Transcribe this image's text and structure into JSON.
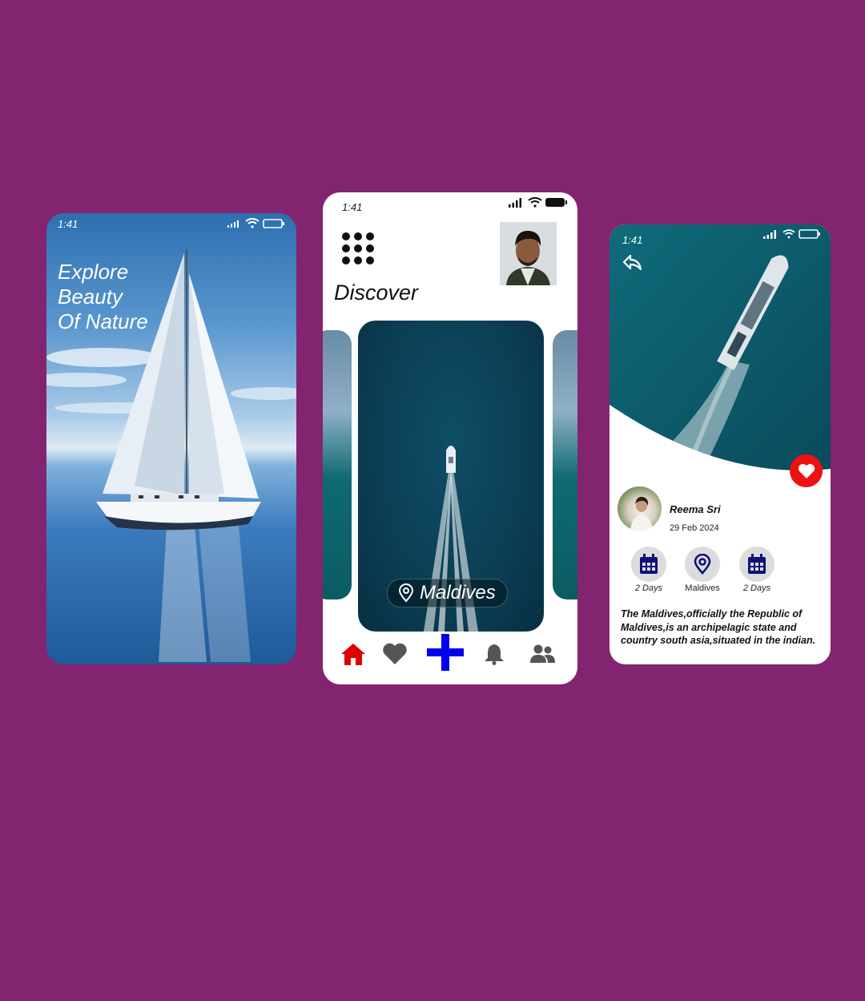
{
  "screen1": {
    "status_time": "1:41",
    "title_lines": [
      "Explore",
      "Beauty",
      "Of Nature"
    ]
  },
  "screen2": {
    "status_time": "1:41",
    "heading": "Discover",
    "card_location": "Maldives",
    "nav": [
      {
        "name": "home-icon",
        "color": "#e00000",
        "active": true
      },
      {
        "name": "heart-icon",
        "color": "#555555"
      },
      {
        "name": "plus-icon",
        "color": "#0000ee"
      },
      {
        "name": "bell-icon",
        "color": "#555555"
      },
      {
        "name": "people-icon",
        "color": "#555555"
      }
    ]
  },
  "screen3": {
    "status_time": "1:41",
    "author_name": "Reema Sri",
    "date": "29 Feb 2024",
    "stats": [
      {
        "icon": "calendar-icon",
        "label": "2 Days"
      },
      {
        "icon": "location-pin-icon",
        "label": "Maldives"
      },
      {
        "icon": "calendar-icon",
        "label": "2 Days"
      }
    ],
    "description": "The Maldives,officially the Republic of Maldives,is an archipelagic state and country south asia,situated in the indian.",
    "accent_color": "#ee1111",
    "icon_color": "#10107a"
  },
  "background_color": "#832470"
}
